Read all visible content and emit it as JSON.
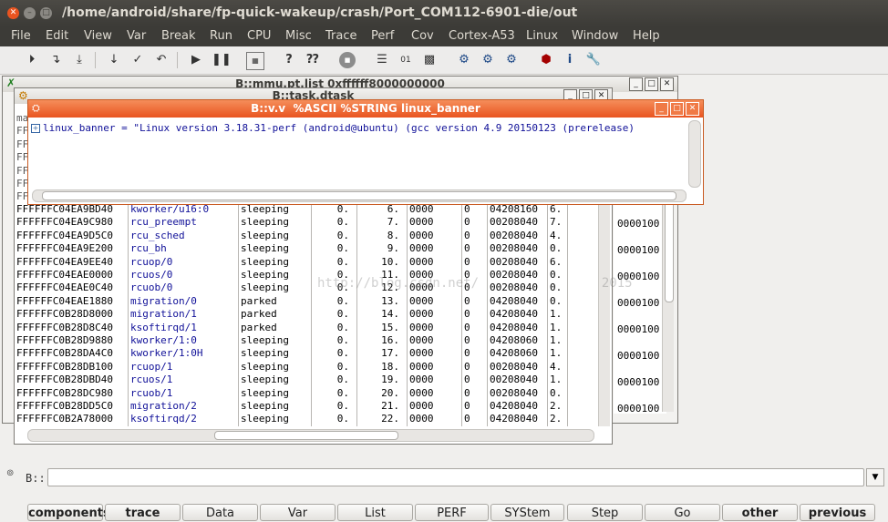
{
  "window": {
    "title": "/home/android/share/fp-quick-wakeup/crash/Port_COM112-6901-die/out"
  },
  "menu": [
    "File",
    "Edit",
    "View",
    "Var",
    "Break",
    "Run",
    "CPU",
    "Misc",
    "Trace",
    "Perf",
    "Cov",
    "Cortex-A53",
    "Linux",
    "Window",
    "Help"
  ],
  "toolbar_icons": [
    "step-into-icon",
    "step-over-icon",
    "step-asm-icon",
    "step-down-icon",
    "return-icon",
    "up-icon",
    "go-icon",
    "break-icon",
    "mode-icon",
    "help-icon",
    "help-context-icon",
    "stop-icon",
    "list-icon",
    "register-icon",
    "memory-icon",
    "cpu-icon",
    "perf-icon",
    "trace-icon",
    "chip-icon",
    "info-icon",
    "settings-icon"
  ],
  "mmu_window": {
    "title": "B::mmu.pt.list 0xffffff8000000000",
    "col_values": [
      "0000100",
      "0000100",
      "0000100",
      "0000100",
      "0000100",
      "0000100",
      "0000100",
      "0000100"
    ]
  },
  "task_window": {
    "title": "B::task.dtask",
    "rows": [
      [
        "FFFFFFC04EA9BD40",
        "kworker/u16:0",
        "sleeping",
        "0.",
        "6.",
        "0000",
        "0",
        "04208160",
        "6."
      ],
      [
        "FFFFFFC04EA9C980",
        "rcu_preempt",
        "sleeping",
        "0.",
        "7.",
        "0000",
        "0",
        "00208040",
        "7."
      ],
      [
        "FFFFFFC04EA9D5C0",
        "rcu_sched",
        "sleeping",
        "0.",
        "8.",
        "0000",
        "0",
        "00208040",
        "4."
      ],
      [
        "FFFFFFC04EA9E200",
        "rcu_bh",
        "sleeping",
        "0.",
        "9.",
        "0000",
        "0",
        "00208040",
        "0."
      ],
      [
        "FFFFFFC04EA9EE40",
        "rcuop/0",
        "sleeping",
        "0.",
        "10.",
        "0000",
        "0",
        "00208040",
        "6."
      ],
      [
        "FFFFFFC04EAE0000",
        "rcuos/0",
        "sleeping",
        "0.",
        "11.",
        "0000",
        "0",
        "00208040",
        "0."
      ],
      [
        "FFFFFFC04EAE0C40",
        "rcuob/0",
        "sleeping",
        "0.",
        "12.",
        "0000",
        "0",
        "00208040",
        "0."
      ],
      [
        "FFFFFFC04EAE1880",
        "migration/0",
        "parked",
        "0.",
        "13.",
        "0000",
        "0",
        "04208040",
        "0."
      ],
      [
        "FFFFFFC0B28D8000",
        "migration/1",
        "parked",
        "0.",
        "14.",
        "0000",
        "0",
        "04208040",
        "1."
      ],
      [
        "FFFFFFC0B28D8C40",
        "ksoftirqd/1",
        "parked",
        "0.",
        "15.",
        "0000",
        "0",
        "04208040",
        "1."
      ],
      [
        "FFFFFFC0B28D9880",
        "kworker/1:0",
        "sleeping",
        "0.",
        "16.",
        "0000",
        "0",
        "04208060",
        "1."
      ],
      [
        "FFFFFFC0B28DA4C0",
        "kworker/1:0H",
        "sleeping",
        "0.",
        "17.",
        "0000",
        "0",
        "04208060",
        "1."
      ],
      [
        "FFFFFFC0B28DB100",
        "rcuop/1",
        "sleeping",
        "0.",
        "18.",
        "0000",
        "0",
        "00208040",
        "4."
      ],
      [
        "FFFFFFC0B28DBD40",
        "rcuos/1",
        "sleeping",
        "0.",
        "19.",
        "0000",
        "0",
        "00208040",
        "1."
      ],
      [
        "FFFFFFC0B28DC980",
        "rcuob/1",
        "sleeping",
        "0.",
        "20.",
        "0000",
        "0",
        "00208040",
        "0."
      ],
      [
        "FFFFFFC0B28DD5C0",
        "migration/2",
        "sleeping",
        "0.",
        "21.",
        "0000",
        "0",
        "04208040",
        "2."
      ],
      [
        "FFFFFFC0B2A78000",
        "ksoftirqd/2",
        "sleeping",
        "0.",
        "22.",
        "0000",
        "0",
        "04208040",
        "2."
      ]
    ],
    "partial_left": [
      "ma",
      "FF",
      "FF",
      "FF",
      "FF",
      "FF",
      "FF"
    ]
  },
  "var_window": {
    "title": "B::v.v  %ASCII %STRING linux_banner",
    "line": "linux_banner = \"Linux version 3.18.31-perf (android@ubuntu) (gcc version 4.9 20150123 (prerelease)"
  },
  "watermark": "http://blog.csdn.net/                2015",
  "command": {
    "prompt": "B::",
    "value": ""
  },
  "softkeys": [
    "components",
    "trace",
    "Data",
    "Var",
    "List",
    "PERF",
    "SYStem",
    "Step",
    "Go",
    "other",
    "previous"
  ]
}
